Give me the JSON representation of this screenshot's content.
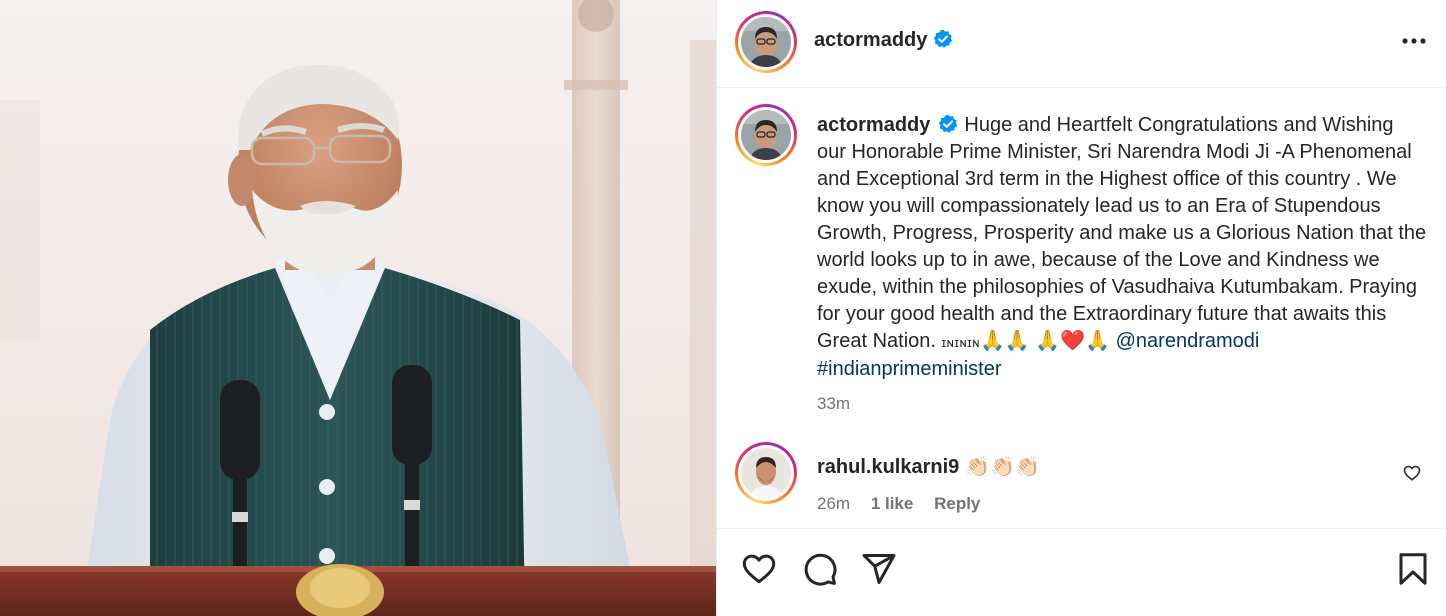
{
  "post": {
    "author": "actormaddy",
    "caption_username": "actormaddy",
    "caption_body": "Huge and Heartfelt Congratulations and Wishing our Honorable Prime Minister, Sri Narendra Modi Ji -A Phenomenal and Exceptional 3rd term in the Highest office of this country . We know you will compassionately lead us to an Era of Stupendous Growth, Progress, Prosperity and make us a Glorious Nation that the world looks up to in awe, because of the Love and Kindness we exude, within the philosophies of Vasudhaiva Kutumbakam. Praying for your good health and the Extraordinary future that awaits this Great Nation.",
    "caption_smallcaps": "ɪɴɪɴɪɴ",
    "emoji_line_1": "🙏🙏",
    "emoji_line_2": "🙏❤️🙏",
    "mention": "@narendramodi",
    "hashtag": "#indianprimeminister",
    "time_ago": "33m"
  },
  "comment": {
    "username": "rahul.kulkarni9",
    "text": "👏🏻👏🏻👏🏻",
    "time_ago": "26m",
    "likes": "1 like",
    "reply_label": "Reply"
  },
  "colors": {
    "verified": "#0095f6",
    "link": "#00376b",
    "muted": "#737373",
    "text": "#262626"
  },
  "icons": {
    "header_menu": "more-horizontal-icon",
    "like": "heart-icon",
    "comment": "comment-icon",
    "share": "paper-plane-icon",
    "save": "bookmark-icon"
  }
}
